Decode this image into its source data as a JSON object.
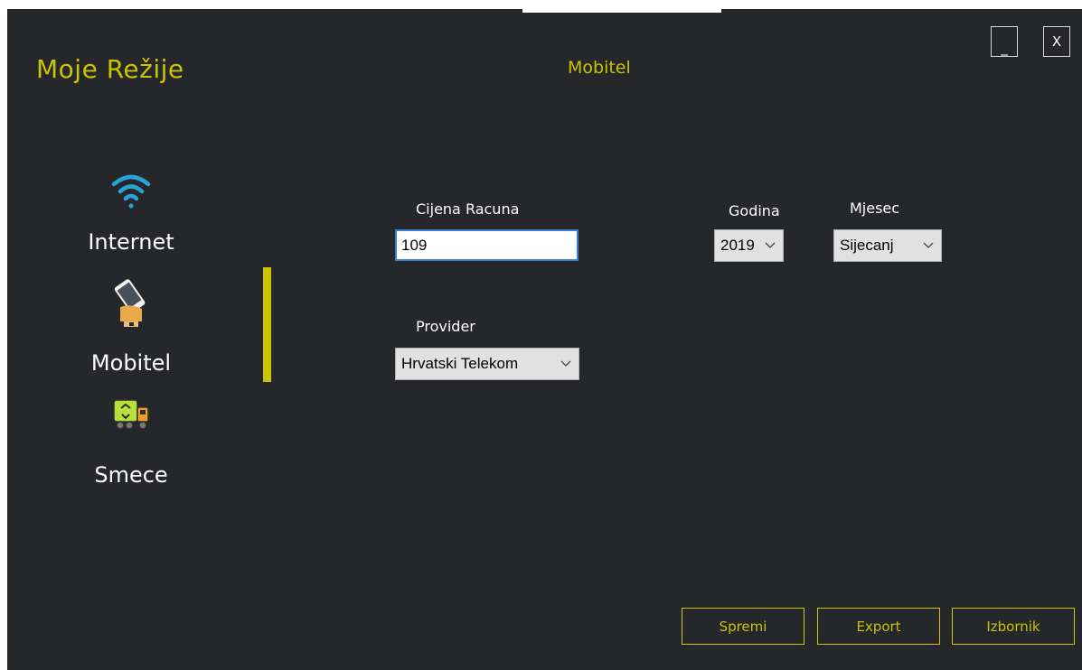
{
  "app": {
    "title": "Moje Režije",
    "page_title": "Mobitel"
  },
  "window_controls": {
    "minimize_label": "_",
    "close_label": "X"
  },
  "sidebar": {
    "items": [
      {
        "label": "Internet",
        "icon": "wifi-icon"
      },
      {
        "label": "Mobitel",
        "icon": "mobile-phone-icon",
        "active": true
      },
      {
        "label": "Smece",
        "icon": "garbage-truck-icon"
      }
    ]
  },
  "form": {
    "price": {
      "label": "Cijena Racuna",
      "value": "109"
    },
    "provider": {
      "label": "Provider",
      "value": "Hrvatski Telekom"
    },
    "year": {
      "label": "Godina",
      "value": "2019"
    },
    "month": {
      "label": "Mjesec",
      "value": "Sijecanj"
    }
  },
  "actions": {
    "save_label": "Spremi",
    "export_label": "Export",
    "menu_label": "Izbornik"
  },
  "colors": {
    "background": "#26272b",
    "accent": "#c8c400",
    "wifi_blue": "#29a3d6",
    "input_focus": "#3b7fd6"
  }
}
